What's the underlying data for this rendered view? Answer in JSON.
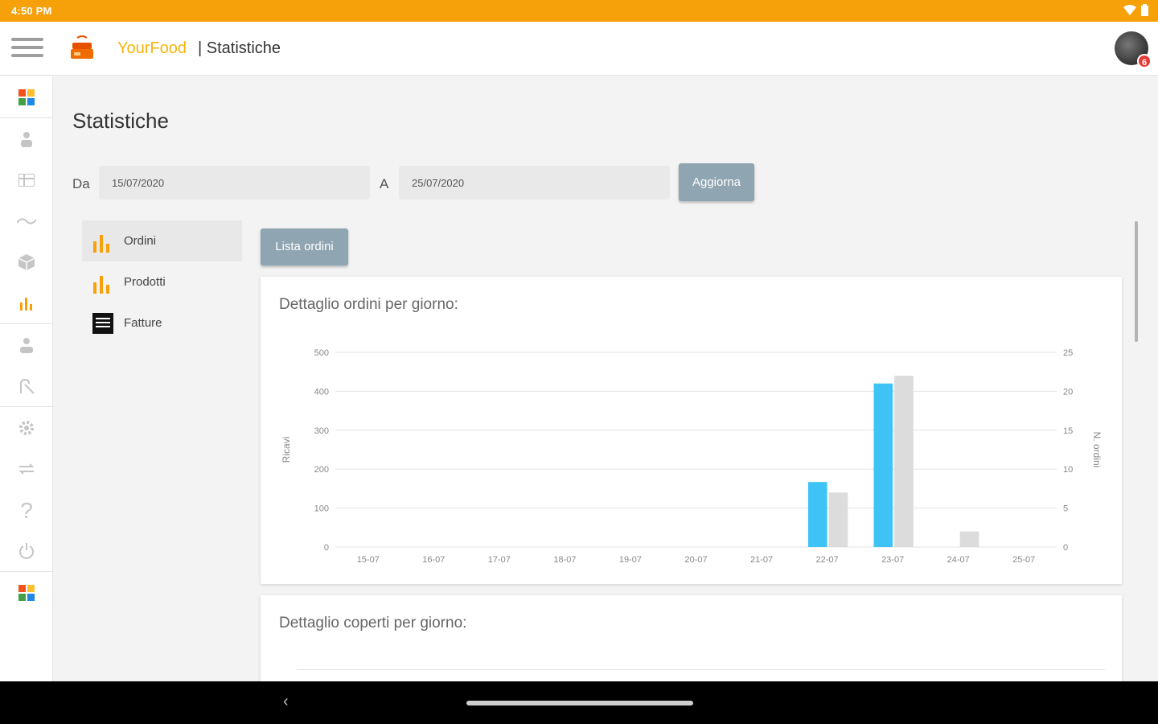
{
  "status_bar": {
    "time": "4:50 PM"
  },
  "app_bar": {
    "brand": "YourFood",
    "section": "| Statistiche",
    "notifications_count": "6"
  },
  "page": {
    "title": "Statistiche",
    "from_label": "Da",
    "from_value": "15/07/2020",
    "to_label": "A",
    "to_value": "25/07/2020",
    "update_button": "Aggiorna"
  },
  "stats_menu": [
    {
      "label": "Ordini",
      "icon": "bar-chart-icon",
      "active": true
    },
    {
      "label": "Prodotti",
      "icon": "bar-chart-icon",
      "active": false
    },
    {
      "label": "Fatture",
      "icon": "invoice-icon",
      "active": false
    }
  ],
  "orders_list_button": "Lista ordini",
  "cards": {
    "orders_title": "Dettaglio ordini per giorno:",
    "covers_title": "Dettaglio coperti per giorno:"
  },
  "colors": {
    "accent": "#f7a10a",
    "bar_primary": "#3fc3f7",
    "bar_secondary": "#dcdcdc",
    "button": "#8fa5b1"
  },
  "chart_data": {
    "type": "bar",
    "categories": [
      "15-07",
      "16-07",
      "17-07",
      "18-07",
      "19-07",
      "20-07",
      "21-07",
      "22-07",
      "23-07",
      "24-07",
      "25-07"
    ],
    "series": [
      {
        "name": "",
        "axis": "left",
        "color": "#3fc3f7",
        "values": [
          0,
          0,
          0,
          0,
          0,
          0,
          0,
          167,
          420,
          0,
          0
        ]
      },
      {
        "name": "",
        "axis": "right",
        "color": "#dcdcdc",
        "values": [
          0,
          0,
          0,
          0,
          0,
          0,
          0,
          7,
          22,
          2,
          0
        ]
      }
    ],
    "ylabel": "Ricavi",
    "y2label": "N. ordini",
    "ylim": [
      0,
      500
    ],
    "y2lim": [
      0,
      25
    ],
    "yticks": [
      "0",
      "100",
      "200",
      "300",
      "400",
      "500"
    ],
    "y2ticks": [
      "0",
      "5",
      "10",
      "15",
      "20",
      "25"
    ],
    "grid": true
  }
}
